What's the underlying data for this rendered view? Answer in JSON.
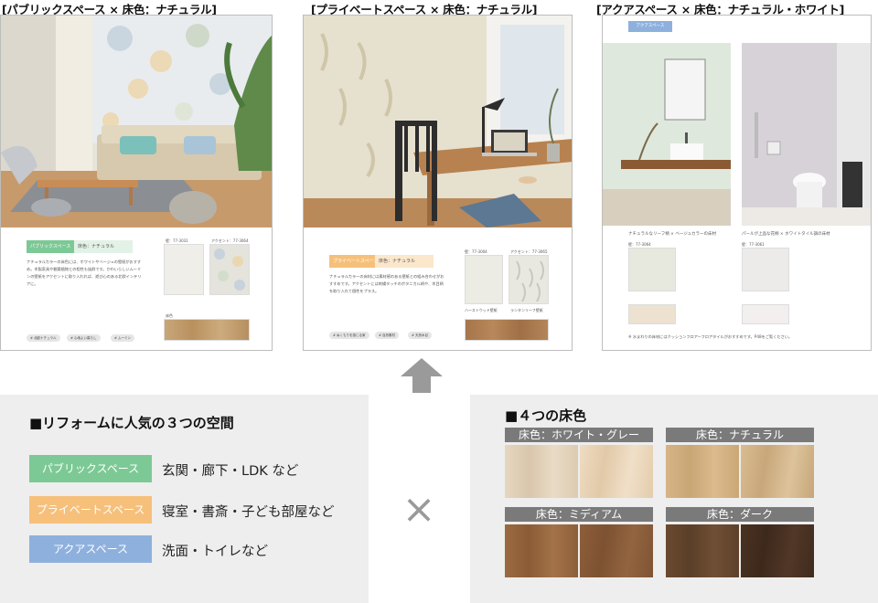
{
  "captions": {
    "public": "[パブリックスペース × 床色：ナチュラル]",
    "private": "[プライベートスペース × 床色：ナチュラル]",
    "aqua": "[アクアスペース × 床色：ナチュラル・ホワイト]"
  },
  "public_page": {
    "label": "パブリックスペース",
    "sublabel": "床色：ナチュラル",
    "text": "ナチュラルカラーの床色には、ホワイトやベージュの壁紙がおすすめ。木製家具や観葉植物との相性も抜群です。かわいらしいムーミンの壁紙をアクセントに取り入れれば、遊び心のある北欧インテリアに。",
    "code1": "壁：77-3031",
    "code2": "アクセント：77-3064",
    "floor_label": "床色",
    "tags": [
      "# 北欧ナチュラル",
      "# 心地よい暮らし",
      "# ムーミン"
    ]
  },
  "private_page": {
    "label": "プライベートスペース",
    "sublabel": "床色：ナチュラル",
    "text": "ナチュラルカラーの床材には素材感のある壁紙との組み合わせがおすすめです。アクセントには刺繍タッチのボタニカル柄や、木目柄を取り入れて個性をプラス。",
    "code1": "壁：77-3004",
    "code2": "アクセント：77-3065",
    "name1": "ハーストウッド壁紙",
    "name2": "ランタンリーフ壁紙",
    "tags": [
      "# ぬくもりを感じる家",
      "# 自然素材",
      "# 天然木目"
    ]
  },
  "aqua_page": {
    "badge": "アクアスペース",
    "caption1": "ナチュラルなリーフ柄 × ベージュカラーの床材",
    "caption2": "パールが上品な花柄 × ホワイトタイル調の床材",
    "code1": "壁：77-3064",
    "code2": "壁：77-3061",
    "note": "※ 水まわりの床材にはクッションフロアーフロアタイルがおすすめです。P48をご覧ください。"
  },
  "spaces": {
    "title": "■リフォームに人気の３つの空間",
    "items": [
      {
        "label": "パブリックスペース",
        "desc": "玄関・廊下・LDK など",
        "color": "#7cc995"
      },
      {
        "label": "プライベートスペース",
        "desc": "寝室・書斎・子ども部屋など",
        "color": "#f6c07a"
      },
      {
        "label": "アクアスペース",
        "desc": "洗面・トイレなど",
        "color": "#8eb0dd"
      }
    ]
  },
  "times": "×",
  "floors": {
    "title": "■４つの床色",
    "items": [
      {
        "label": "床色：ホワイト・グレー"
      },
      {
        "label": "床色：ナチュラル"
      },
      {
        "label": "床色：ミディアム"
      },
      {
        "label": "床色：ダーク"
      }
    ]
  }
}
